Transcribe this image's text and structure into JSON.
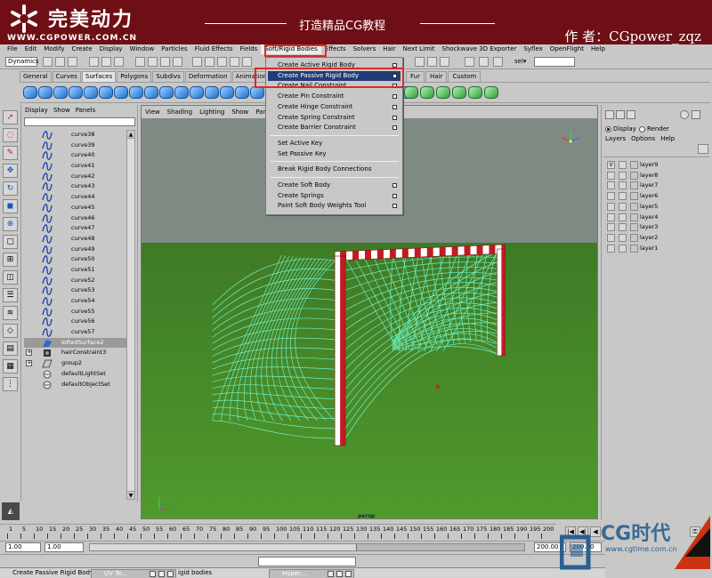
{
  "banner": {
    "brand_cn": "完美动力",
    "brand_url": "WWW.CGPOWER.COM.CN",
    "tagline": "打造精品CG教程",
    "author": "作 者：CGpower_zqz"
  },
  "menubar": {
    "items": [
      "File",
      "Edit",
      "Modify",
      "Create",
      "Display",
      "Window",
      "Particles",
      "Fluid Effects",
      "Fields",
      "Soft/Rigid Bodies",
      "Effects",
      "Solvers",
      "Hair",
      "Next Limit",
      "Shockwave 3D Exporter",
      "Syflex",
      "OpenFlight",
      "Help"
    ],
    "active_index": 9
  },
  "statusline": {
    "mode": "Dynamics",
    "sel_label": "sel▾"
  },
  "shelf": {
    "tabs": [
      "General",
      "Curves",
      "Surfaces",
      "Polygons",
      "Subdivs",
      "Deformation",
      "Animation",
      "Dynamics"
    ],
    "active_tab": "Surfaces",
    "tabs_right": [
      "Fur",
      "Hair",
      "Custom"
    ]
  },
  "outliner": {
    "menu": [
      "Display",
      "Show",
      "Panels"
    ],
    "items": [
      {
        "label": "curve38",
        "type": "curve"
      },
      {
        "label": "curve39",
        "type": "curve"
      },
      {
        "label": "curve40",
        "type": "curve"
      },
      {
        "label": "curve41",
        "type": "curve"
      },
      {
        "label": "curve42",
        "type": "curve"
      },
      {
        "label": "curve43",
        "type": "curve"
      },
      {
        "label": "curve44",
        "type": "curve"
      },
      {
        "label": "curve45",
        "type": "curve"
      },
      {
        "label": "curve46",
        "type": "curve"
      },
      {
        "label": "curve47",
        "type": "curve"
      },
      {
        "label": "curve48",
        "type": "curve"
      },
      {
        "label": "curve49",
        "type": "curve"
      },
      {
        "label": "curve50",
        "type": "curve"
      },
      {
        "label": "curve51",
        "type": "curve"
      },
      {
        "label": "curve52",
        "type": "curve"
      },
      {
        "label": "curve53",
        "type": "curve"
      },
      {
        "label": "curve54",
        "type": "curve"
      },
      {
        "label": "curve55",
        "type": "curve"
      },
      {
        "label": "curve56",
        "type": "curve"
      },
      {
        "label": "curve57",
        "type": "curve"
      },
      {
        "label": "loftedSurface2",
        "type": "surface"
      },
      {
        "label": "hairConstraint3",
        "type": "constraint"
      },
      {
        "label": "group2",
        "type": "group"
      },
      {
        "label": "defaultLightSet",
        "type": "set"
      },
      {
        "label": "defaultObjectSet",
        "type": "set"
      }
    ],
    "selected": "loftedSurface2"
  },
  "viewport": {
    "menu": [
      "View",
      "Shading",
      "Lighting",
      "Show",
      "Panels"
    ],
    "camera": "persp",
    "colors": {
      "background": "#7f8a83",
      "ground": "#4a8a2a",
      "net": "#6ff0c2",
      "post_red": "#c21b23"
    }
  },
  "dropdown": {
    "groups": [
      [
        "Create Active Rigid Body",
        "Create Passive Rigid Body",
        "Create Nail Constraint",
        "Create Pin Constraint",
        "Create Hinge Constraint",
        "Create Spring Constraint",
        "Create Barrier Constraint"
      ],
      [
        "Set Active Key",
        "Set Passive Key"
      ],
      [
        "Break Rigid Body Connections"
      ],
      [
        "Create Soft Body",
        "Create Springs",
        "Paint Soft Body Weights Tool"
      ]
    ],
    "highlighted": "Create Passive Rigid Body",
    "highlight_color": "#e02828"
  },
  "layers": {
    "display_mode": "Display",
    "render_mode": "Render",
    "menu": [
      "Layers",
      "Options",
      "Help"
    ],
    "items": [
      "layer9",
      "layer8",
      "layer7",
      "layer6",
      "layer5",
      "layer4",
      "layer3",
      "layer2",
      "layer1"
    ],
    "visible_mark": "V"
  },
  "timeline": {
    "ticks": [
      "1",
      "5",
      "10",
      "15",
      "20",
      "25",
      "30",
      "35",
      "40",
      "45",
      "50",
      "55",
      "60",
      "65",
      "70",
      "75",
      "80",
      "85",
      "90",
      "95",
      "100",
      "105",
      "110",
      "115",
      "120",
      "125",
      "130",
      "135",
      "140",
      "145",
      "150",
      "155",
      "160",
      "165",
      "170",
      "175",
      "180",
      "185",
      "190",
      "195",
      "200"
    ],
    "start": "1.00",
    "current": "1.00",
    "end_anim": "200.00",
    "end_range": "200.00"
  },
  "helpline": {
    "text": "Create Passive Rigid Body: S",
    "tasks": [
      "UV Te...",
      "Hyper..."
    ],
    "fragment": "igid bodies"
  },
  "watermark": {
    "text": "CG时代",
    "url": "www.cgtime.com.cn"
  }
}
